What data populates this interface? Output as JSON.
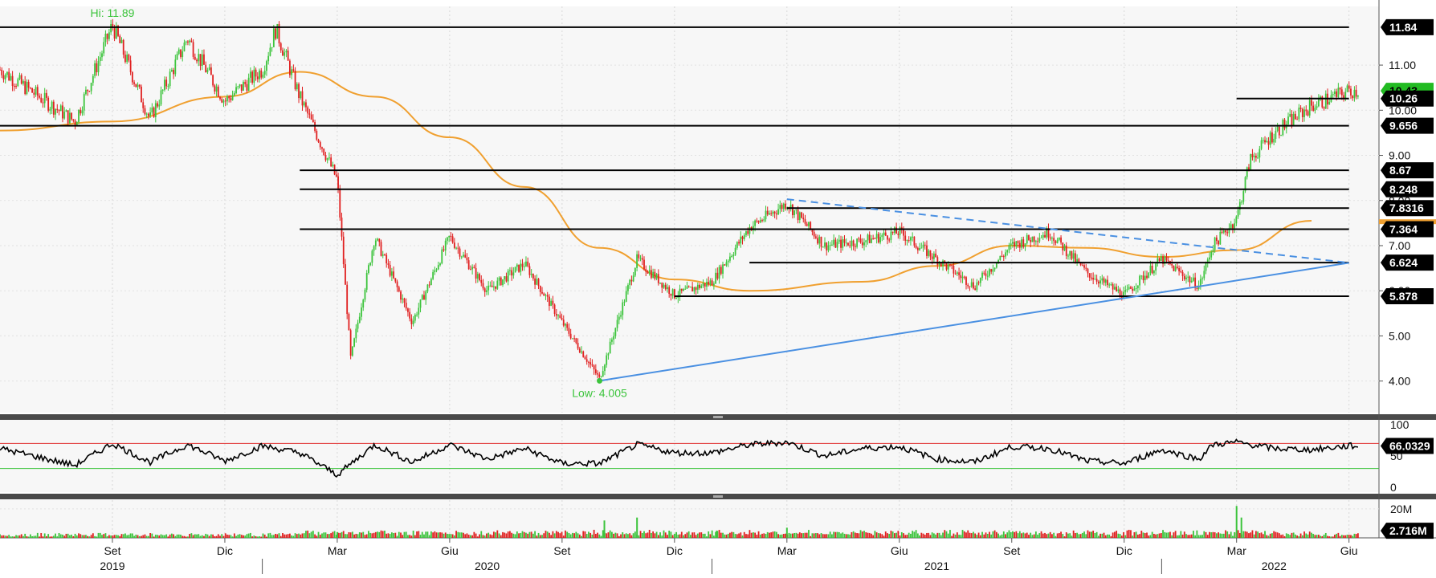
{
  "chart_data": [
    {
      "panel": "price",
      "type": "candlestick",
      "hi_label": "Hi: 11.89",
      "low_label": "Low: 4.005",
      "y_ticks": [
        "11.00",
        "10.00",
        "9.00",
        "8.00",
        "7.00",
        "6.00",
        "5.00",
        "4.00"
      ],
      "ylim": [
        3.3,
        12.3
      ],
      "last_price": "10.43",
      "horizontal_levels": [
        {
          "label": "11.84",
          "value": 11.84,
          "from": "2019-06",
          "to": "2022-06"
        },
        {
          "label": "10.26",
          "value": 10.26,
          "from": "2022-03",
          "to": "2022-06"
        },
        {
          "label": "9.656",
          "value": 9.656,
          "from": "2019-06",
          "to": "2022-06"
        },
        {
          "label": "8.67",
          "value": 8.67,
          "from": "2020-02",
          "to": "2022-06"
        },
        {
          "label": "8.248",
          "value": 8.248,
          "from": "2020-02",
          "to": "2022-06"
        },
        {
          "label": "7.8316",
          "value": 7.8316,
          "from": "2021-03",
          "to": "2022-06"
        },
        {
          "label": "7.364",
          "value": 7.364,
          "from": "2020-02",
          "to": "2022-06"
        },
        {
          "label": "6.624",
          "value": 6.624,
          "from": "2021-02",
          "to": "2022-06"
        },
        {
          "label": "5.878",
          "value": 5.878,
          "from": "2020-12",
          "to": "2022-06"
        }
      ],
      "trendlines": [
        {
          "style": "solid",
          "color": "#4a90e2",
          "from": {
            "date": "2020-10",
            "price": 4.005
          },
          "to": {
            "date": "2022-06",
            "price": 6.62
          }
        },
        {
          "style": "dashed",
          "color": "#4a90e2",
          "from": {
            "date": "2021-03",
            "price": 8.03
          },
          "to": {
            "date": "2022-06",
            "price": 6.62
          }
        }
      ],
      "moving_average": {
        "color": "#f0a030",
        "points": [
          [
            "2019-06",
            9.55
          ],
          [
            "2019-09",
            9.75
          ],
          [
            "2019-12",
            10.3
          ],
          [
            "2020-02",
            10.85
          ],
          [
            "2020-04",
            10.3
          ],
          [
            "2020-06",
            9.4
          ],
          [
            "2020-08",
            8.3
          ],
          [
            "2020-10",
            6.95
          ],
          [
            "2020-12",
            6.25
          ],
          [
            "2021-02",
            6.0
          ],
          [
            "2021-05",
            6.2
          ],
          [
            "2021-07",
            6.55
          ],
          [
            "2021-09",
            7.0
          ],
          [
            "2021-11",
            6.95
          ],
          [
            "2022-01",
            6.75
          ],
          [
            "2022-03",
            6.9
          ],
          [
            "2022-05",
            7.55
          ]
        ]
      },
      "price_path": [
        [
          "2019-06",
          10.9
        ],
        [
          "2019-08",
          9.75
        ],
        [
          "2019-09",
          11.89
        ],
        [
          "2019-10",
          9.8
        ],
        [
          "2019-11",
          11.6
        ],
        [
          "2019-12",
          10.2
        ],
        [
          "2020-01",
          10.9
        ],
        [
          "2020-01",
          11.8
        ],
        [
          "2020-02",
          10.3
        ],
        [
          "2020-03",
          8.45
        ],
        [
          "2020-03",
          4.5
        ],
        [
          "2020-04",
          7.2
        ],
        [
          "2020-05",
          5.3
        ],
        [
          "2020-06",
          7.2
        ],
        [
          "2020-07",
          6.0
        ],
        [
          "2020-08",
          6.6
        ],
        [
          "2020-09",
          5.3
        ],
        [
          "2020-10",
          4.05
        ],
        [
          "2020-11",
          6.7
        ],
        [
          "2020-12",
          5.9
        ],
        [
          "2021-01",
          6.2
        ],
        [
          "2021-02",
          7.4
        ],
        [
          "2021-03",
          7.95
        ],
        [
          "2021-04",
          7.0
        ],
        [
          "2021-05",
          7.1
        ],
        [
          "2021-06",
          7.3
        ],
        [
          "2021-07",
          6.7
        ],
        [
          "2021-08",
          6.1
        ],
        [
          "2021-09",
          7.0
        ],
        [
          "2021-10",
          7.3
        ],
        [
          "2021-11",
          6.4
        ],
        [
          "2021-12",
          5.9
        ],
        [
          "2022-01",
          6.7
        ],
        [
          "2022-02",
          6.1
        ],
        [
          "2022-02",
          7.0
        ],
        [
          "2022-03",
          7.6
        ],
        [
          "2022-03",
          8.9
        ],
        [
          "2022-04",
          9.5
        ],
        [
          "2022-05",
          10.1
        ],
        [
          "2022-06",
          10.43
        ]
      ]
    },
    {
      "panel": "rsi",
      "type": "line",
      "y_ticks": [
        "100",
        "50",
        "0"
      ],
      "ylim": [
        0,
        100
      ],
      "upper_band": 70,
      "lower_band": 30,
      "last_value_label": "66.0329",
      "last_value": 66.0329,
      "points": [
        [
          "2019-06",
          62
        ],
        [
          "2019-08",
          35
        ],
        [
          "2019-09",
          70
        ],
        [
          "2019-10",
          40
        ],
        [
          "2019-11",
          68
        ],
        [
          "2019-12",
          42
        ],
        [
          "2020-01",
          66
        ],
        [
          "2020-02",
          55
        ],
        [
          "2020-03",
          20
        ],
        [
          "2020-04",
          68
        ],
        [
          "2020-05",
          40
        ],
        [
          "2020-06",
          68
        ],
        [
          "2020-07",
          45
        ],
        [
          "2020-08",
          62
        ],
        [
          "2020-09",
          38
        ],
        [
          "2020-10",
          38
        ],
        [
          "2020-11",
          68
        ],
        [
          "2020-12",
          55
        ],
        [
          "2021-01",
          55
        ],
        [
          "2021-02",
          68
        ],
        [
          "2021-03",
          72
        ],
        [
          "2021-04",
          50
        ],
        [
          "2021-05",
          62
        ],
        [
          "2021-06",
          65
        ],
        [
          "2021-07",
          45
        ],
        [
          "2021-08",
          40
        ],
        [
          "2021-09",
          65
        ],
        [
          "2021-10",
          62
        ],
        [
          "2021-11",
          42
        ],
        [
          "2021-12",
          38
        ],
        [
          "2022-01",
          60
        ],
        [
          "2022-02",
          45
        ],
        [
          "2022-02",
          68
        ],
        [
          "2022-03",
          72
        ],
        [
          "2022-04",
          62
        ],
        [
          "2022-05",
          60
        ],
        [
          "2022-06",
          66.03
        ]
      ]
    },
    {
      "panel": "volume",
      "type": "bar",
      "y_ticks": [
        "20M"
      ],
      "last_value_label": "2.716M",
      "last_value": 2716000,
      "spikes": [
        [
          "2020-03",
          4000000
        ],
        [
          "2020-10",
          12000000
        ],
        [
          "2020-11",
          14000000
        ],
        [
          "2021-01",
          5000000
        ],
        [
          "2021-03",
          7000000
        ],
        [
          "2021-11",
          4000000
        ],
        [
          "2022-03",
          22000000
        ],
        [
          "2022-03",
          14000000
        ]
      ]
    }
  ],
  "x_axis": {
    "months": [
      {
        "label": "Set",
        "date": "2019-09"
      },
      {
        "label": "Dic",
        "date": "2019-12"
      },
      {
        "label": "Mar",
        "date": "2020-03"
      },
      {
        "label": "Giu",
        "date": "2020-06"
      },
      {
        "label": "Set",
        "date": "2020-09"
      },
      {
        "label": "Dic",
        "date": "2020-12"
      },
      {
        "label": "Mar",
        "date": "2021-03"
      },
      {
        "label": "Giu",
        "date": "2021-06"
      },
      {
        "label": "Set",
        "date": "2021-09"
      },
      {
        "label": "Dic",
        "date": "2021-12"
      },
      {
        "label": "Mar",
        "date": "2022-03"
      },
      {
        "label": "Giu",
        "date": "2022-06"
      }
    ],
    "years": [
      {
        "label": "2019",
        "date": "2019-09"
      },
      {
        "label": "2020",
        "date": "2020-07"
      },
      {
        "label": "2021",
        "date": "2021-07"
      },
      {
        "label": "2022",
        "date": "2022-04"
      }
    ]
  },
  "colors": {
    "up": "#3cc43c",
    "down": "#e02020",
    "moving_average": "#f0a030",
    "trendline": "#4a90e2",
    "rsi_upper": "#e03030",
    "rsi_lower": "#3cc43c",
    "last_price_tag": "#22bb22"
  }
}
